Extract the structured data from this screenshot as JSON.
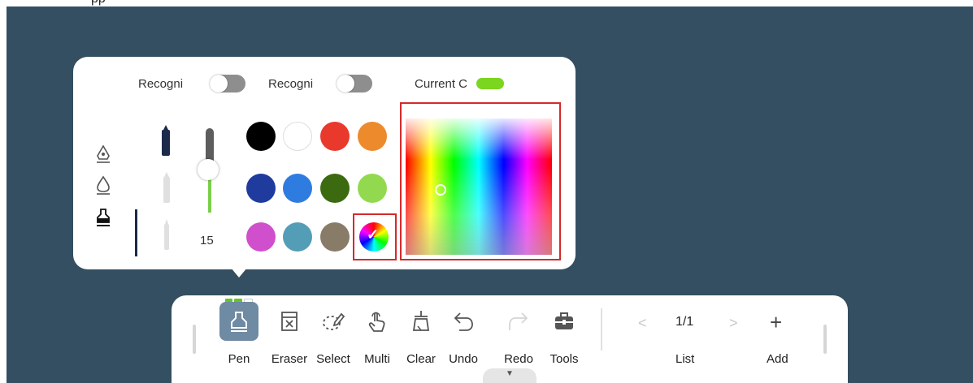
{
  "top_fragment": "pp",
  "popup": {
    "toggles": [
      {
        "label": "Recogni",
        "state": "off"
      },
      {
        "label": "Recogni",
        "state": "off"
      },
      {
        "label": "Current C",
        "state": "on"
      }
    ],
    "pen_types": [
      "fountain-pen-icon",
      "marker-icon",
      "highlighter-icon"
    ],
    "selected_pen_type": "highlighter-icon",
    "pen_size_value": "15",
    "swatches": [
      "#000000",
      "#ffffff",
      "#e9392c",
      "#ec8a2c",
      "#1f3b9e",
      "#2f7ce0",
      "#3c6a10",
      "#93d94f",
      "#d04fcc",
      "#549db7",
      "#887b68"
    ],
    "custom_color_icon": "color-wheel-icon",
    "current_color": "#7ad61e"
  },
  "toolbar": {
    "tools": [
      {
        "label": "Pen",
        "icon": "pen-icon"
      },
      {
        "label": "Eraser",
        "icon": "eraser-icon"
      },
      {
        "label": "Select",
        "icon": "lasso-icon"
      },
      {
        "label": "Multi",
        "icon": "multi-touch-icon"
      },
      {
        "label": "Clear",
        "icon": "clear-icon"
      },
      {
        "label": "Undo",
        "icon": "undo-icon"
      },
      {
        "label": "Redo",
        "icon": "redo-icon"
      },
      {
        "label": "Tools",
        "icon": "toolbox-icon"
      }
    ],
    "page_indicator": "1/1",
    "list_label": "List",
    "add_label": "Add",
    "prev_glyph": "<",
    "next_glyph": ">",
    "add_glyph": "+"
  }
}
